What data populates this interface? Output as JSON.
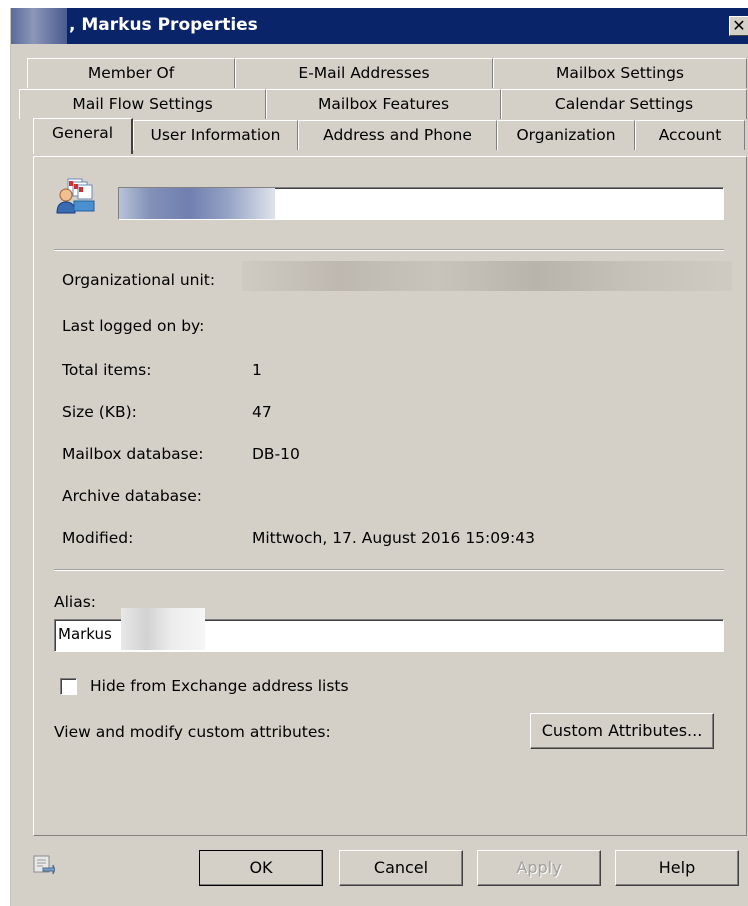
{
  "window": {
    "title": ", Markus Properties",
    "close_glyph": "✕"
  },
  "tabs": {
    "row1": [
      "Member Of",
      "E-Mail Addresses",
      "Mailbox Settings"
    ],
    "row2": [
      "Mail Flow Settings",
      "Mailbox Features",
      "Calendar Settings"
    ],
    "row3": [
      "General",
      "User Information",
      "Address and Phone",
      "Organization",
      "Account"
    ],
    "active": "General"
  },
  "general": {
    "display_name": "",
    "fields": [
      {
        "label": "Organizational unit:",
        "value": ""
      },
      {
        "label": "Last logged on by:",
        "value": ""
      },
      {
        "label": "Total items:",
        "value": "1"
      },
      {
        "label": "Size (KB):",
        "value": "47"
      },
      {
        "label": "Mailbox database:",
        "value": "DB-10"
      },
      {
        "label": "Archive database:",
        "value": ""
      },
      {
        "label": "Modified:",
        "value": "Mittwoch, 17. August 2016 15:09:43"
      }
    ],
    "alias_label": "Alias:",
    "alias_value": "Markus",
    "hide_checkbox_label": "Hide from Exchange address lists",
    "hide_checked": false,
    "custom_attributes_label": "View and modify custom attributes:",
    "custom_attributes_button": "Custom Attributes..."
  },
  "footer": {
    "ok": "OK",
    "cancel": "Cancel",
    "apply": "Apply",
    "help": "Help"
  },
  "icons": {
    "mailbox_user": "user-mailbox-icon",
    "script": "export-script-icon"
  },
  "colors": {
    "titlebar": "#0a246a",
    "face": "#d4d0c8"
  }
}
